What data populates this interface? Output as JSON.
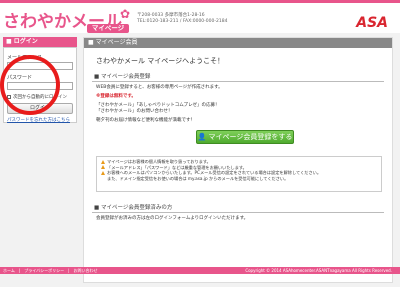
{
  "header": {
    "logo_main": "さわやかメール",
    "logo_sub": "マイページ",
    "logo_mark": "✿",
    "address_line1": "〒208-0033 多摩市落合1-28-16",
    "address_line2": "TEL:0120-183-211 / FAX:0000-000-2184",
    "brand": "ASA"
  },
  "sidebar": {
    "title": "ログイン",
    "email_label": "メールアドレス",
    "password_label": "パスワード",
    "remember_label": "次回から自動的にログイン",
    "login_button": "ログイン",
    "forgot_link": "パスワードを忘れた方はこちら"
  },
  "main": {
    "title": "マイページ会員",
    "welcome": "さわやかメール マイページへようこそ！",
    "register_section": {
      "heading": "マイページ会員登録",
      "line1": "WEB会員に登録すると、お客様の専用ページが作成されます。",
      "free_notice": "※登録は無料です。",
      "line2": "「さわやかメール」「あしゃべりドットコムプレゼ」の応募！",
      "line3": "「さわやかメール」のお問い合わせ！",
      "line4": "朝夕刊のお届け情報など便利な機能が満載です！",
      "button": "マイページ会員登録をする"
    },
    "notices": [
      "マイページはお客様の個人情報を取り扱っております。",
      "「メールアドレス」「パスワード」などは厳重な管理をお願いいたします。",
      "お客様へのメールはパソコンからいたします。PCメール受信の設定をされている場合は設定を解除してください。",
      "また、ドメイン指定受信をお使いの場合は my.asa.jp からのメールを受信可能にしてください。"
    ],
    "registered_section": {
      "heading": "マイページ会員登録済みの方",
      "line1": "会員登録がお済みの方は左のログインフォームよりログインいただけます。"
    }
  },
  "footer": {
    "links": [
      "ホーム",
      "プライバシーポリシー",
      "お問い合わせ"
    ],
    "copyright": "Copyright © 2014 ASAhomecenter.ASANTnagayama All Rights Reserved."
  },
  "colors": {
    "brand_pink": "#e8558b",
    "asa_red": "#d9252f",
    "button_green": "#4faa2e"
  }
}
